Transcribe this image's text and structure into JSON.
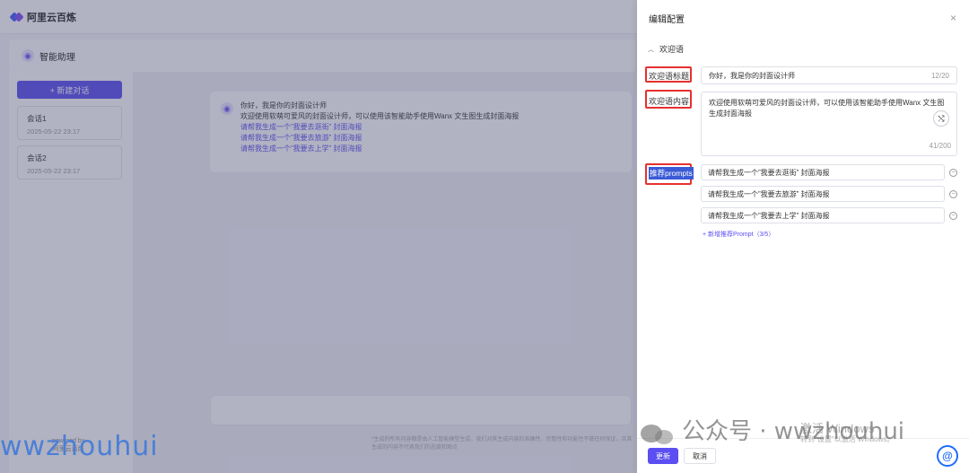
{
  "app": {
    "brand": "阿里云百炼",
    "assistant_title": "智能助理",
    "new_chat_label": "+ 新建对话",
    "sessions": [
      {
        "name": "会话1",
        "time": "2025-05-22 23:17"
      },
      {
        "name": "会话2",
        "time": "2025-05-22 23:17"
      }
    ],
    "powered_by": "powered by",
    "powered_name": "阿里云百炼",
    "welcome": {
      "title": "你好，我是你的封面设计师",
      "content": "欢迎使用软萌可爱风的封面设计师，可以使用该智能助手使用Wanx 文生图生成封面海报",
      "links": [
        "请帮我生成一个”我要去逛街”  封面海报",
        "请帮我生成一个”我要去旅游”  封面海报",
        "请帮我生成一个”我要去上学”  封面海报"
      ]
    },
    "disclaimer": "*生成的所有内容都是由人工智能模型生成，我们对其生成内容的准确性、完整性和功能性不做任何保证，且其生成的内容不代表我们的态度和观点"
  },
  "drawer": {
    "title": "编辑配置",
    "close_icon": "×",
    "section_label": "欢迎语",
    "welcome_title_label": "欢迎语标题",
    "welcome_title_value": "你好，我是你的封面设计师",
    "welcome_title_count": "12/20",
    "welcome_content_label": "欢迎语内容",
    "welcome_content_value": "欢迎使用软萌可爱风的封面设计师，可以使用该智能助手使用Wanx 文生图生成封面海报",
    "welcome_content_count": "41/200",
    "prompts_label": "推荐prompts",
    "prompts": [
      "请帮我生成一个”我要去逛街” 封面海报",
      "请帮我生成一个”我要去旅游” 封面海报",
      "请帮我生成一个”我要去上学” 封面海报"
    ],
    "add_prompt": "+ 新增推荐Prompt（3/5）",
    "update_label": "更新",
    "cancel_label": "取消"
  },
  "watermarks": {
    "left": "wwzhouhui",
    "right": "公众号 · wwzhouhui",
    "activate": "激活 Windows",
    "activate_sub": "转到\"设置\"以激活 Windows。"
  },
  "colors": {
    "accent": "#5b4ff2",
    "highlight_box": "#e5312f",
    "prompt_label_bg": "#3b5bd6"
  }
}
